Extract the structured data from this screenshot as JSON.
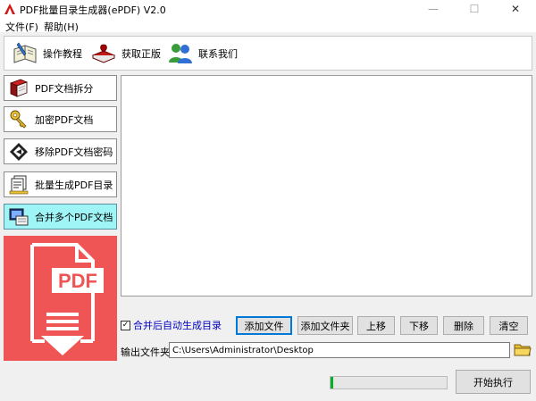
{
  "window": {
    "title": "PDF批量目录生成器(ePDF) V2.0",
    "min_glyph": "—",
    "max_glyph": "☐",
    "close_glyph": "✕"
  },
  "menu": {
    "file": "文件(F)",
    "help": "帮助(H)"
  },
  "toolbar": {
    "tutorial": "操作教程",
    "genuine": "获取正版",
    "contact": "联系我们"
  },
  "sidebar": {
    "items": [
      {
        "label": "PDF文档拆分",
        "icon": "book-split-icon",
        "active": false
      },
      {
        "label": "加密PDF文档",
        "icon": "keys-icon",
        "active": false
      },
      {
        "label": "移除PDF文档密码",
        "icon": "unlock-diamond-icon",
        "active": false
      },
      {
        "label": "批量生成PDF目录",
        "icon": "documents-icon",
        "active": false
      },
      {
        "label": "合并多个PDF文档",
        "icon": "merge-monitor-icon",
        "active": true
      }
    ],
    "banner_text": "PDF"
  },
  "main": {
    "auto_toc_label": "合并后自动生成目录",
    "auto_toc_checked": true,
    "check_glyph": "✓",
    "buttons": {
      "add_file": "添加文件",
      "add_folder": "添加文件夹",
      "move_up": "上移",
      "move_down": "下移",
      "delete": "删除",
      "clear": "清空"
    },
    "output_label": "输出文件夹",
    "output_path": "C:\\Users\\Administrator\\Desktop",
    "progress_percent": 2,
    "start_button": "开始执行"
  },
  "colors": {
    "banner_red": "#f05555",
    "active_item": "#9ff5f5",
    "checkbox_label": "#0000c0",
    "progress_green": "#06b025",
    "focus_blue": "#0078d7"
  }
}
